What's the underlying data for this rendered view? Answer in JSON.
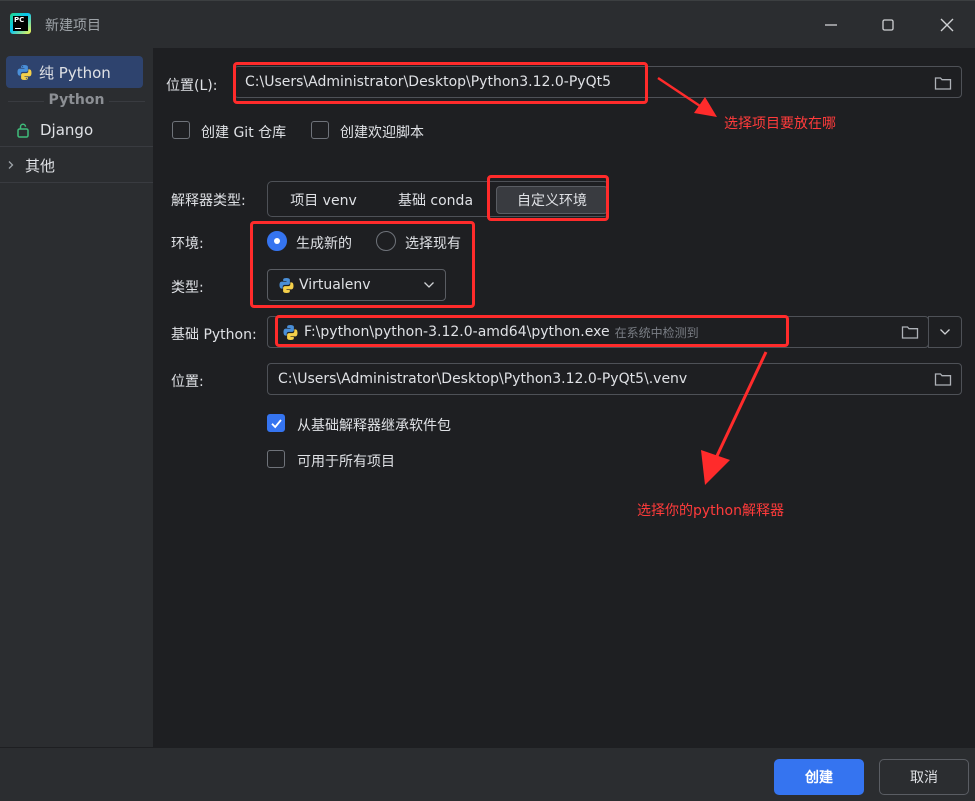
{
  "window": {
    "title": "新建项目"
  },
  "sidebar": {
    "items": [
      {
        "label": "纯 Python",
        "active": true
      },
      {
        "label": "Django"
      },
      {
        "label": "其他"
      }
    ],
    "section_label": "Python"
  },
  "form": {
    "location_label": "位置(L):",
    "location_value": "C:\\Users\\Administrator\\Desktop\\Python3.12.0-PyQt5",
    "create_git_label": "创建 Git 仓库",
    "create_welcome_label": "创建欢迎脚本",
    "interpreter_type_label": "解释器类型:",
    "interpreter_types": [
      "项目 venv",
      "基础 conda",
      "自定义环境"
    ],
    "interpreter_type_selected": "自定义环境",
    "env_label": "环境:",
    "env_options": [
      "生成新的",
      "选择现有"
    ],
    "env_selected": "生成新的",
    "type_label": "类型:",
    "type_value": "Virtualenv",
    "base_python_label": "基础 Python:",
    "base_python_value": "F:\\python\\python-3.12.0-amd64\\python.exe",
    "base_python_hint": "在系统中检测到",
    "venv_location_label": "位置:",
    "venv_location_value": "C:\\Users\\Administrator\\Desktop\\Python3.12.0-PyQt5\\.venv",
    "inherit_label": "从基础解释器继承软件包",
    "inherit_checked": true,
    "all_projects_label": "可用于所有项目",
    "all_projects_checked": false
  },
  "annotations": {
    "location_note": "选择项目要放在哪",
    "interpreter_note": "选择你的python解释器"
  },
  "footer": {
    "create_label": "创建",
    "cancel_label": "取消"
  },
  "colors": {
    "accent": "#3574f0",
    "annotation": "#ff2b2b",
    "background": "#1e1f22",
    "panel": "#2b2d30"
  }
}
